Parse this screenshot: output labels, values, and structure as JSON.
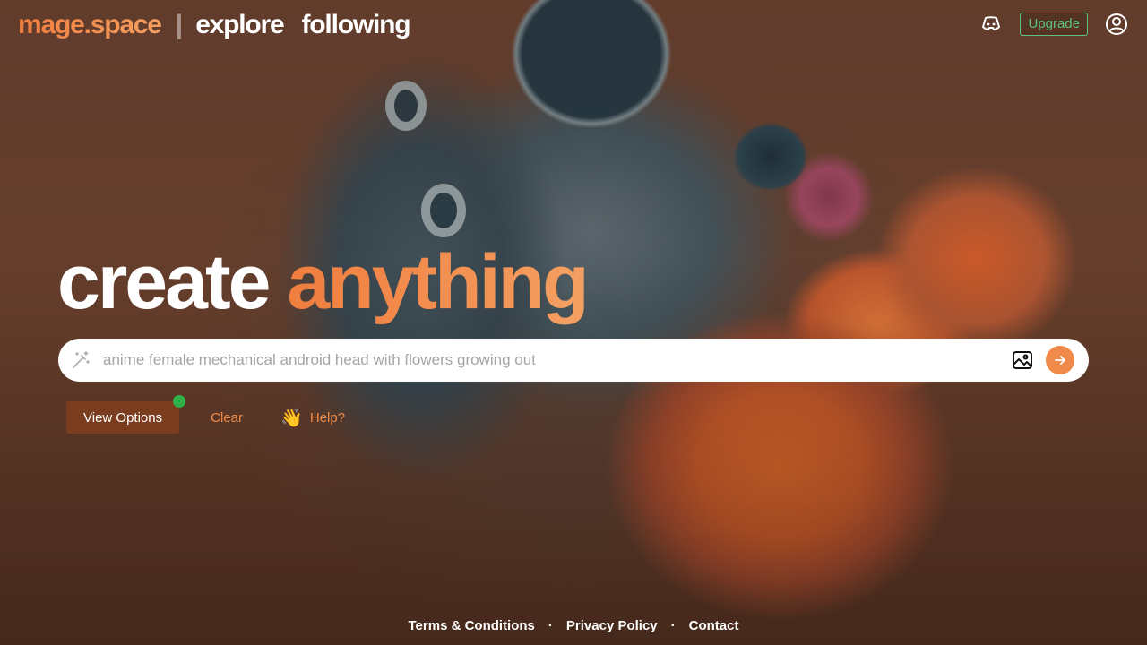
{
  "header": {
    "logo": "mage.space",
    "separator": "|",
    "nav": [
      "explore",
      "following"
    ],
    "upgrade_label": "Upgrade",
    "icons": [
      "discord-icon",
      "account-icon"
    ]
  },
  "hero": {
    "word1": "create",
    "word2": "anything"
  },
  "search": {
    "placeholder": "anime female mechanical android head with flowers growing out",
    "value": "",
    "icons": [
      "magic-wand-icon",
      "image-upload-icon",
      "arrow-right-icon"
    ]
  },
  "options": {
    "view_options_label": "View Options",
    "clear_label": "Clear",
    "help_emoji": "👋",
    "help_label": "Help?"
  },
  "footer": {
    "links": [
      "Terms & Conditions",
      "Privacy Policy",
      "Contact"
    ],
    "separator": "·"
  },
  "colors": {
    "accent": "#f08a46",
    "upgrade_green": "#5ec27a",
    "notification_dot": "#2fb04a",
    "view_options_bg": "#7a3d1f"
  }
}
